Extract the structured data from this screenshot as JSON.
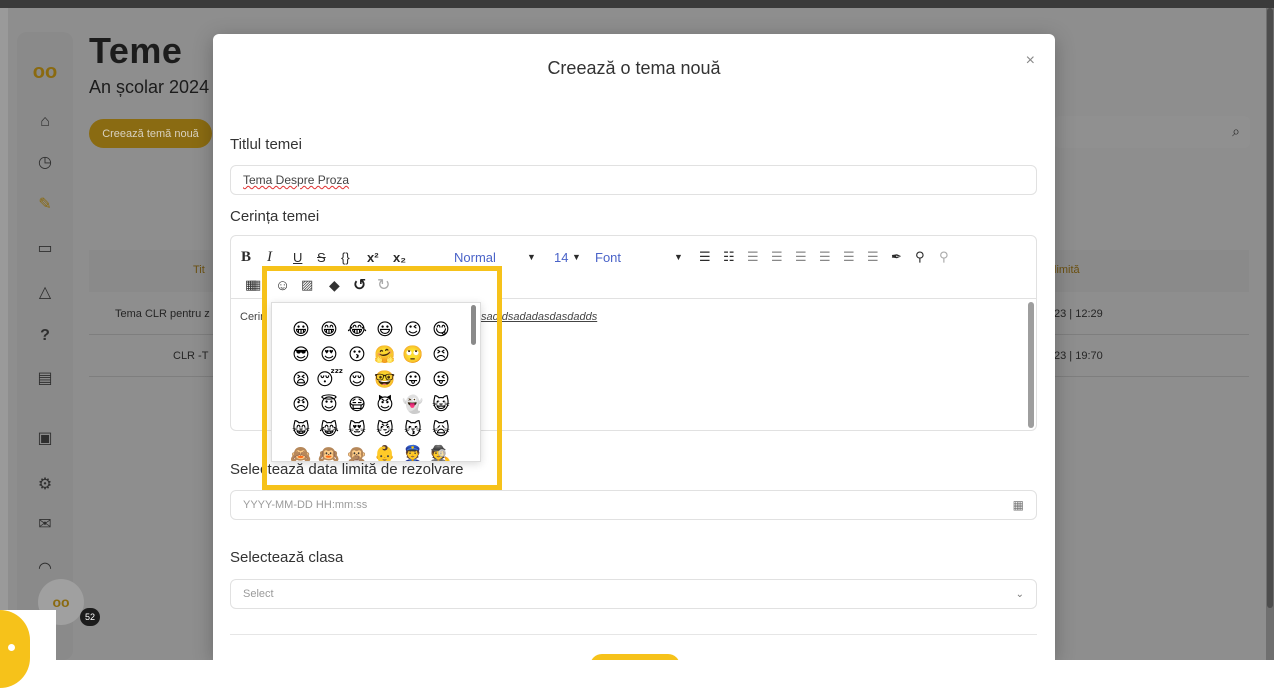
{
  "background": {
    "page_title": "Teme",
    "page_subtitle": "An școlar 2024",
    "create_button": "Creează temă nouă",
    "table": {
      "header_col1": "Tit",
      "header_col_last": "limită",
      "rows": [
        {
          "title": "Tema CLR pentru z",
          "deadline": "23 | 12:29"
        },
        {
          "title": "CLR -T",
          "deadline": "23 | 19:70"
        }
      ]
    },
    "notification_count": "52",
    "brand_short": "oo"
  },
  "modal": {
    "title": "Creează o tema nouă",
    "close_glyph": "×",
    "title_label": "Titlul temei",
    "title_value": "Tema Despre Proza",
    "requirement_label": "Cerința temei",
    "toolbar": {
      "bold": "B",
      "italic": "I",
      "underline": "U",
      "strike": "S",
      "code": "{}",
      "superscript": "x²",
      "subscript": "x₂",
      "style_select": "Normal",
      "size_select": "14",
      "font_select": "Font"
    },
    "editor_text_visible": "Cerin",
    "editor_text_tail": "sad  dsadadasdasdadds",
    "deadline_label": "Selectează data limită de rezolvare",
    "deadline_placeholder": "YYYY-MM-DD HH:mm:ss",
    "class_label": "Selectează clasa",
    "class_placeholder": "Select"
  },
  "emoji_picker": {
    "rows": [
      [
        "😀",
        "😁",
        "😂",
        "😃",
        "😉",
        "😋"
      ],
      [
        "😎",
        "😍",
        "😗",
        "🤗",
        "🙄",
        "😣"
      ],
      [
        "😫",
        "😴",
        "😌",
        "🤓",
        "😛",
        "😜"
      ],
      [
        "😠",
        "😇",
        "😷",
        "😈",
        "👻",
        "😺"
      ],
      [
        "😸",
        "😹",
        "😻",
        "😼",
        "😽",
        "🙀"
      ],
      [
        "🙈",
        "🙉",
        "🙊",
        "👶",
        "👮",
        "🕵"
      ]
    ]
  }
}
